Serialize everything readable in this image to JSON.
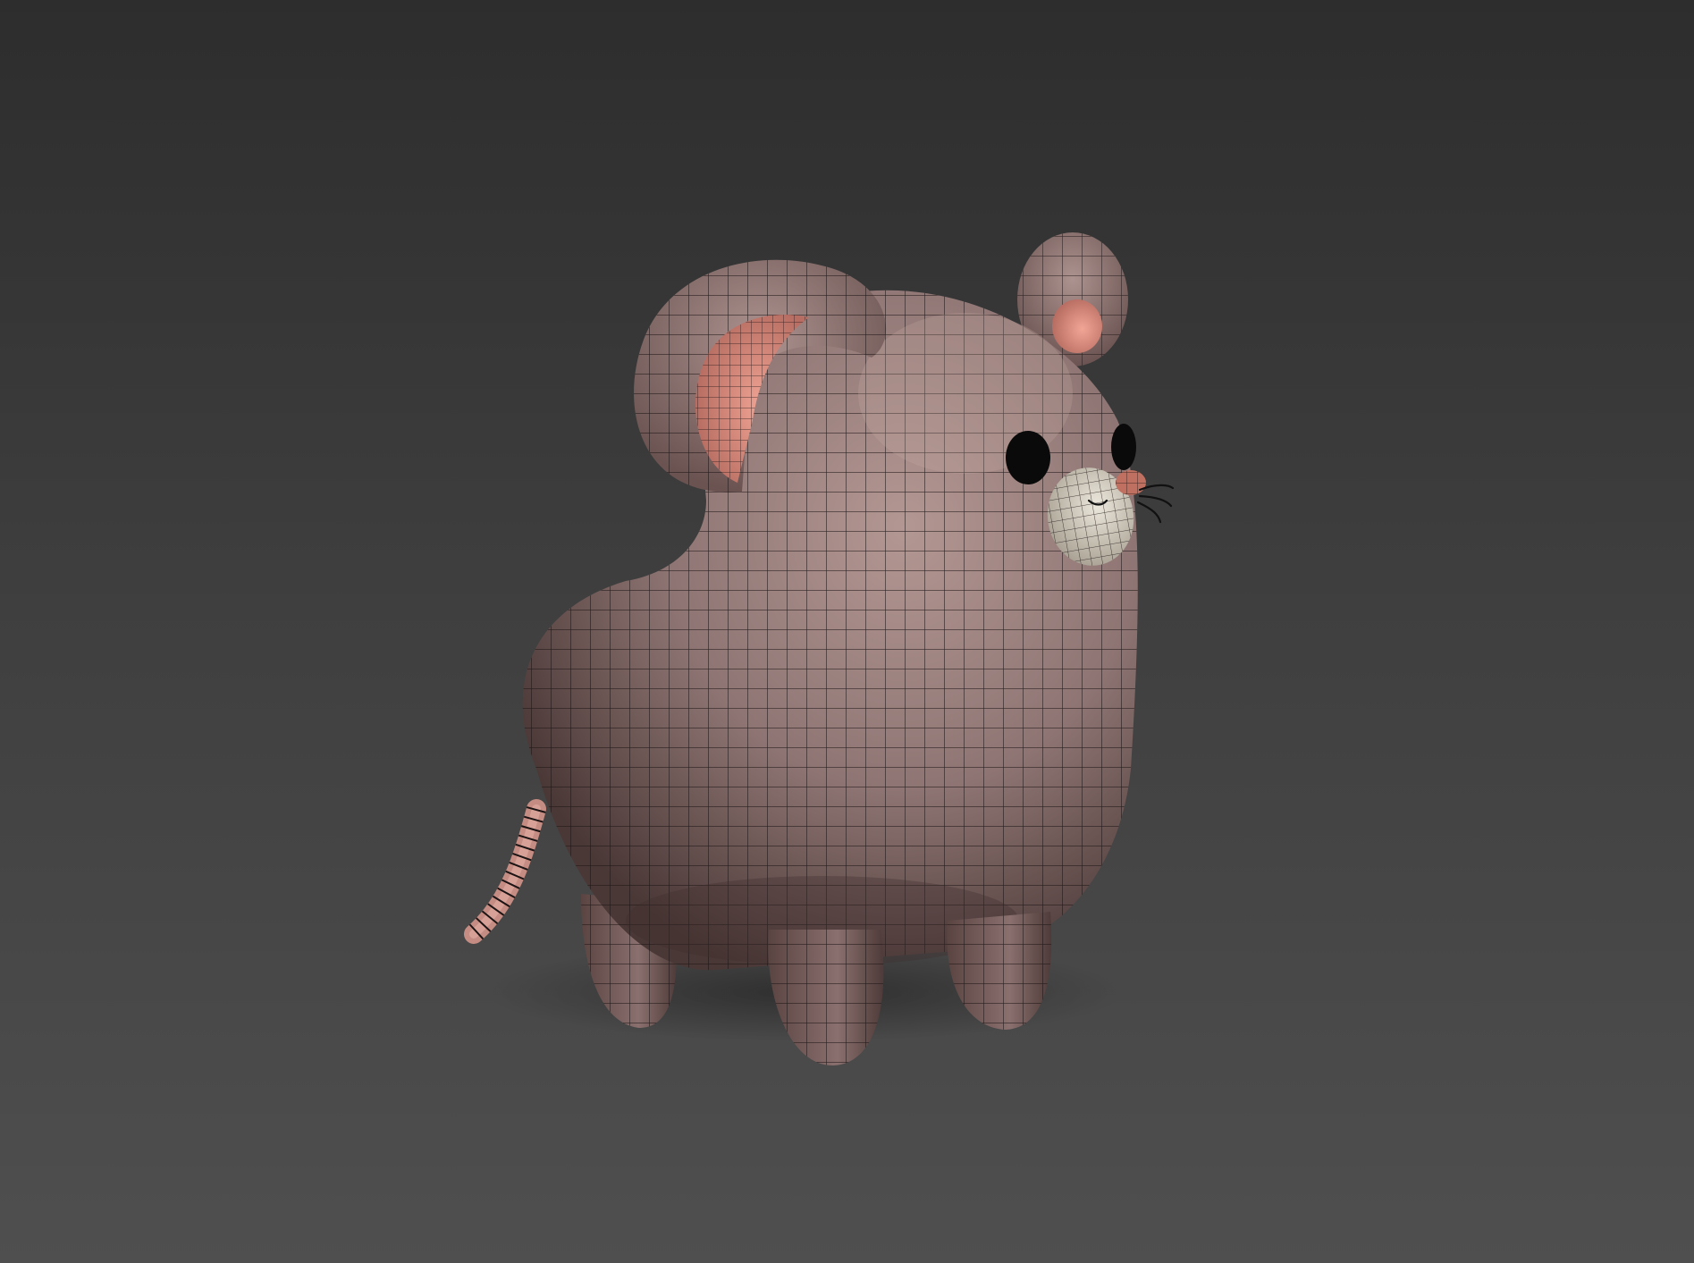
{
  "scene": {
    "subject": "mouse-model",
    "colors": {
      "background_top": "#2d2d2d",
      "background_bottom": "#4f4f4f",
      "body": "#8c7472",
      "body_light": "#a78d89",
      "body_dark": "#4a3836",
      "ear_inner": "#d98a7e",
      "muzzle": "#d8d2c6",
      "nose": "#c07060",
      "eyes": "#0a0a0a",
      "tail": "#d09a90",
      "wire": "#1c1414"
    }
  }
}
